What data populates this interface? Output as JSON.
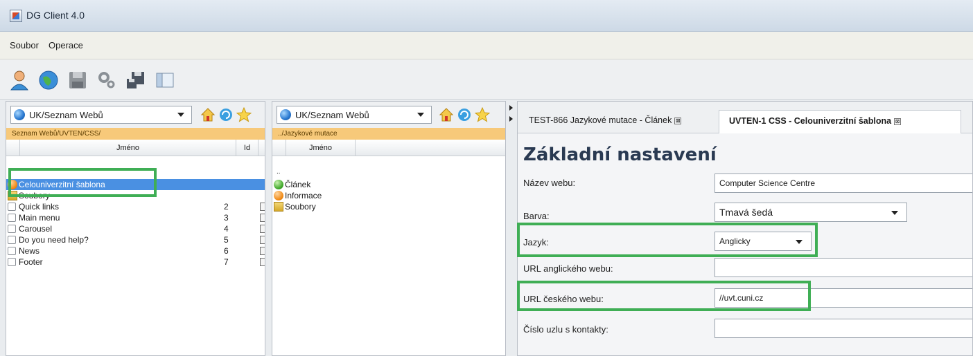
{
  "app": {
    "title": "DG Client 4.0"
  },
  "menu": {
    "items": [
      "Soubor",
      "Operace"
    ]
  },
  "toolbar": {
    "buttons": [
      "user-icon",
      "globe-icon",
      "save-icon",
      "settings-icon",
      "network-save-icon",
      "window-icon"
    ]
  },
  "left_pane": {
    "combo_value": "UK/Seznam Webů",
    "path": "Seznam Webů/UVTEN/CSS/",
    "columns": [
      "Jméno",
      "Id"
    ],
    "rows": [
      {
        "name": "Celouniverzitní šablona",
        "id": "",
        "icon": "orange-dot-icon"
      },
      {
        "name": "Soubory",
        "id": "",
        "icon": "folder-icon"
      },
      {
        "name": "Quick links",
        "id": "2",
        "icon": "link-icon"
      },
      {
        "name": "Main menu",
        "id": "3",
        "icon": "link-icon"
      },
      {
        "name": "Carousel",
        "id": "4",
        "icon": "link-icon"
      },
      {
        "name": "Do you need help?",
        "id": "5",
        "icon": "link-icon"
      },
      {
        "name": "News",
        "id": "6",
        "icon": "link-icon"
      },
      {
        "name": "Footer",
        "id": "7",
        "icon": "link-icon"
      }
    ]
  },
  "middle_pane": {
    "combo_value": "UK/Seznam Webů",
    "path": "../Jazykové mutace",
    "column": "Jméno",
    "parent": "..",
    "rows": [
      {
        "name": "Článek",
        "icon": "green-dot-icon"
      },
      {
        "name": "Informace",
        "icon": "orange-dot-icon"
      },
      {
        "name": "Soubory",
        "icon": "folder-icon"
      }
    ]
  },
  "right_pane": {
    "tabs": [
      "TEST-866 Jazykové mutace - Článek",
      "UVTEN-1 CSS - Celouniverzitní šablona"
    ],
    "tab_close": "⊠",
    "form_title": "Základní nastavení",
    "fields": [
      {
        "label": "Název webu:",
        "value": "Computer Science Centre",
        "type": "text"
      },
      {
        "label": "Barva:",
        "value": "Tmavá šedá",
        "type": "select"
      },
      {
        "label": "Jazyk:",
        "value": "Anglicky",
        "type": "select"
      },
      {
        "label": "URL anglického webu:",
        "value": "",
        "type": "text"
      },
      {
        "label": "URL českého webu:",
        "value": "//uvt.cuni.cz",
        "type": "text"
      },
      {
        "label": "Číslo uzlu s kontakty:",
        "value": "",
        "type": "text"
      }
    ]
  },
  "colors": {
    "highlight": "#3fae55",
    "path_bar": "#f7c97a",
    "selected_row": "#4a90e2"
  }
}
